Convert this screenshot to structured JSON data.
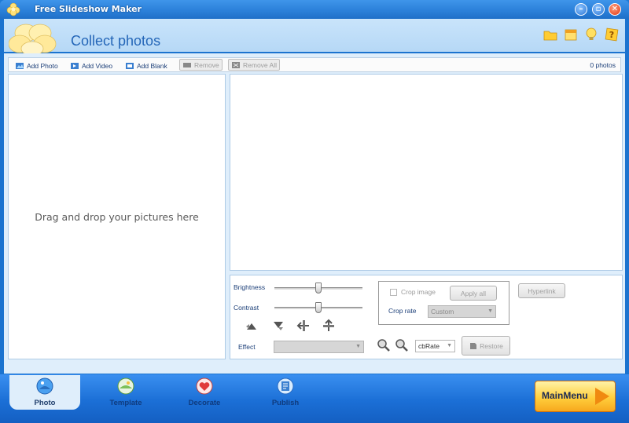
{
  "window": {
    "title": "Free Slideshow Maker",
    "minimize_icon": "minus",
    "maximize_icon": "square",
    "close_icon": "x"
  },
  "header": {
    "title": "Collect photos"
  },
  "toolbar": {
    "add_photo": "Add Photo",
    "add_video": "Add Video",
    "add_blank": "Add Blank",
    "remove": "Remove",
    "remove_all": "Remove All",
    "count": "0 photos"
  },
  "left_pane": {
    "hint": "Drag and drop your pictures here"
  },
  "properties": {
    "brightness_label": "Brightness",
    "brightness_value": 0.5,
    "contrast_label": "Contrast",
    "contrast_value": 0.5,
    "effect_label": "Effect",
    "effect_value": "",
    "crop_image_label": "Crop image",
    "apply_all": "Apply all",
    "crop_rate_label": "Crop rate",
    "crop_rate_value": "Custom",
    "hyperlink": "Hyperlink",
    "rate_value": "cbRate",
    "restore": "Restore"
  },
  "tabs": [
    {
      "label": "Photo",
      "active": true
    },
    {
      "label": "Template",
      "active": false
    },
    {
      "label": "Decorate",
      "active": false
    },
    {
      "label": "Publish",
      "active": false
    }
  ],
  "main_menu": {
    "label": "MainMenu"
  },
  "colors": {
    "accent": "#1b73cf",
    "header_bg": "#c9e4fb",
    "title_text": "#2466b8",
    "main_menu": "#ffcf3d"
  }
}
